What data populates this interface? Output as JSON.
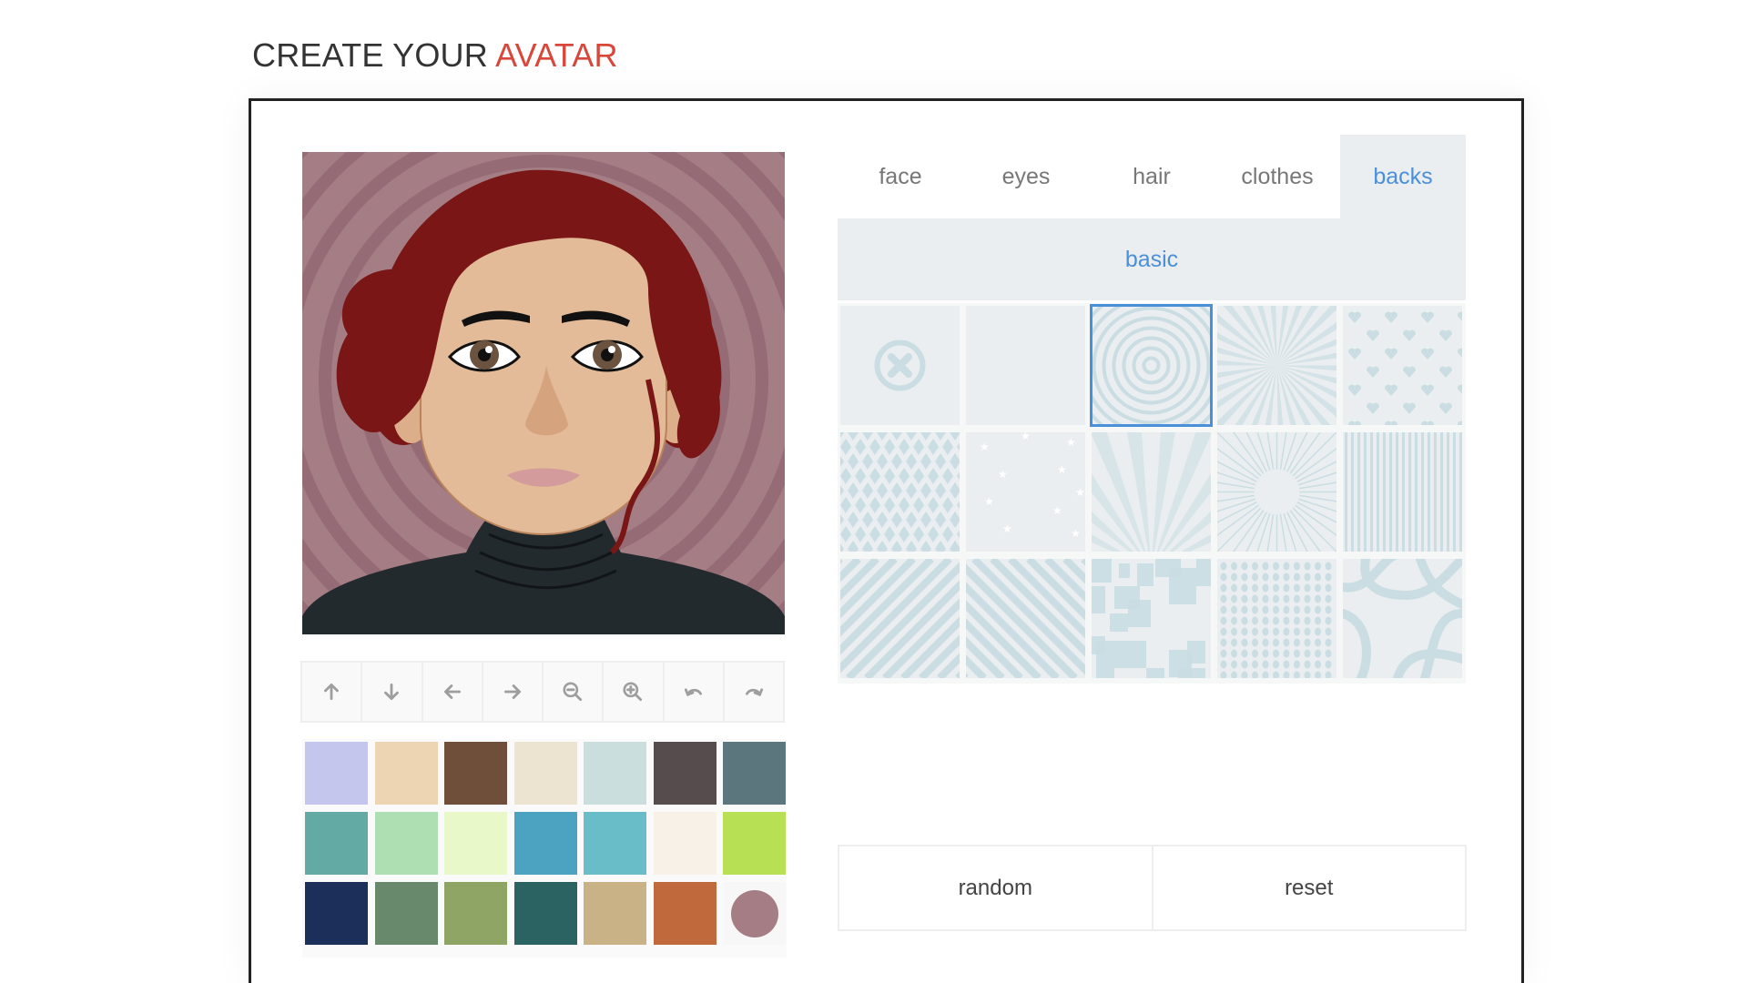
{
  "header": {
    "title_prefix": "CREATE YOUR",
    "title_accent": "AVATAR"
  },
  "colors": {
    "title_text": "#333333",
    "title_accent": "#d9473a",
    "active_tab": "#4a90d9",
    "selected_background": "#a47e84",
    "pattern_tint": "#c9dde2"
  },
  "preview": {
    "description": "Cartoon avatar with red wavy hair, brown eyes, black turtleneck on spiral background",
    "background_color": "#a47e84",
    "hair_color": "#7a1616",
    "skin_color": "#e3bb98",
    "clothes_color": "#232a2e"
  },
  "toolbar": {
    "buttons": [
      {
        "name": "move-up",
        "icon": "arrow-up-icon"
      },
      {
        "name": "move-down",
        "icon": "arrow-down-icon"
      },
      {
        "name": "move-left",
        "icon": "arrow-left-icon"
      },
      {
        "name": "move-right",
        "icon": "arrow-right-icon"
      },
      {
        "name": "zoom-out",
        "icon": "zoom-out-icon"
      },
      {
        "name": "zoom-in",
        "icon": "zoom-in-icon"
      },
      {
        "name": "undo",
        "icon": "undo-icon"
      },
      {
        "name": "redo",
        "icon": "redo-icon"
      }
    ]
  },
  "swatches": {
    "colors": [
      "#c5c6ee",
      "#edd4b2",
      "#6f4e3a",
      "#ece3d0",
      "#cadedd",
      "#564c4d",
      "#5b777d",
      "#63aaa5",
      "#addfb3",
      "#e9f8c8",
      "#4ba3c1",
      "#68bdc8",
      "#f7f1e7",
      "#b8e055",
      "#1c2f5a",
      "#68896c",
      "#8ea565",
      "#2b6262",
      "#c9b386",
      "#c0693d",
      "#a47e84"
    ],
    "selected_index": 20
  },
  "tabs": {
    "items": [
      {
        "label": "face"
      },
      {
        "label": "eyes"
      },
      {
        "label": "hair"
      },
      {
        "label": "clothes"
      },
      {
        "label": "backs"
      }
    ],
    "active_index": 4
  },
  "subtabs": {
    "items": [
      {
        "label": "basic"
      }
    ],
    "active_index": 0
  },
  "backgrounds": {
    "tiles": [
      {
        "pattern": "none"
      },
      {
        "pattern": "plain"
      },
      {
        "pattern": "concentric-circles"
      },
      {
        "pattern": "sunburst"
      },
      {
        "pattern": "hearts"
      },
      {
        "pattern": "harlequin-diamonds"
      },
      {
        "pattern": "stars"
      },
      {
        "pattern": "rays-bottom"
      },
      {
        "pattern": "speed-lines"
      },
      {
        "pattern": "vertical-stripes"
      },
      {
        "pattern": "diagonal-stripes-right"
      },
      {
        "pattern": "diagonal-stripes-left"
      },
      {
        "pattern": "squares"
      },
      {
        "pattern": "dots"
      },
      {
        "pattern": "curves"
      }
    ],
    "selected_index": 2
  },
  "actions": {
    "random_label": "random",
    "reset_label": "reset"
  }
}
